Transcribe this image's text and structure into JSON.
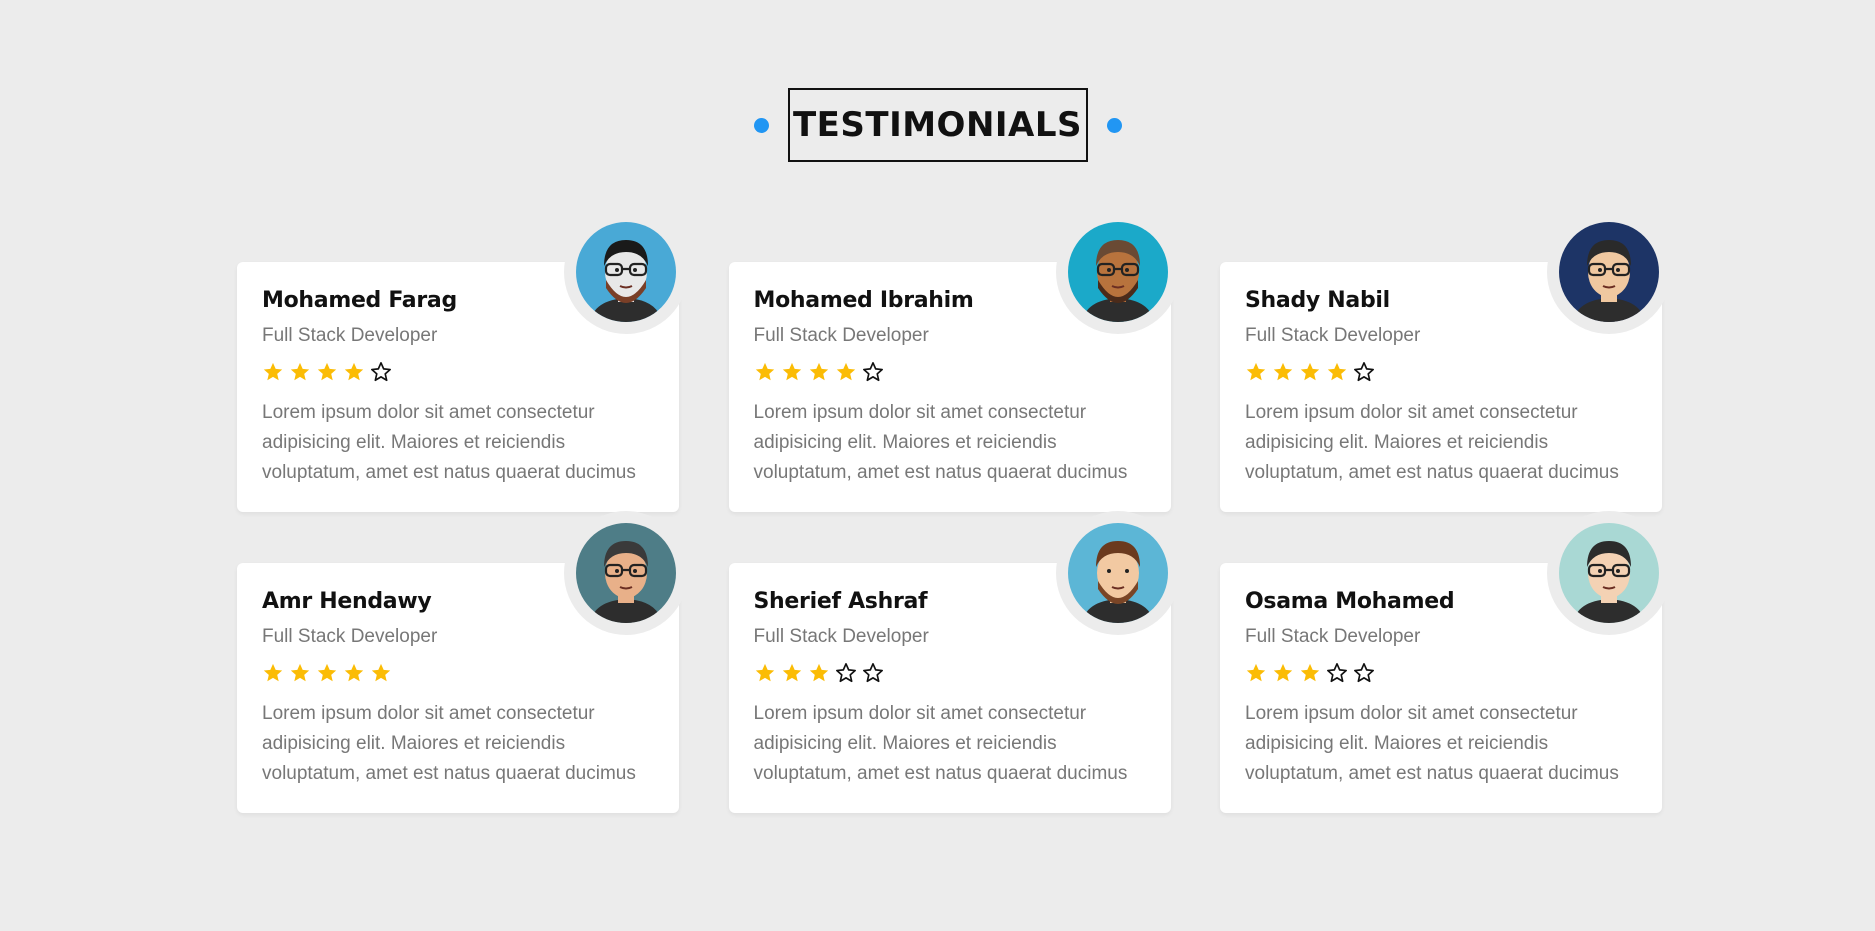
{
  "heading": {
    "title": "TESTIMONIALS",
    "accent_color": "#2196f3"
  },
  "colors": {
    "star_filled": "#fbbc05",
    "star_empty_outline": "#111111"
  },
  "testimonials": [
    {
      "name": "Mohamed Farag",
      "role": "Full Stack Developer",
      "rating": 4,
      "max_rating": 5,
      "text": "Lorem ipsum dolor sit amet consectetur adipisicing elit. Maiores et reiciendis voluptatum, amet est natus quaerat ducimus",
      "avatar": {
        "icon": "avatar-bearded-beanie-icon",
        "bg": "#49a9d6",
        "skin": "#e8e8e8",
        "hair": "#1a1a1a",
        "beard": "#7a3f27",
        "glasses": true
      }
    },
    {
      "name": "Mohamed Ibrahim",
      "role": "Full Stack Developer",
      "rating": 4,
      "max_rating": 5,
      "text": "Lorem ipsum dolor sit amet consectetur adipisicing elit. Maiores et reiciendis voluptatum, amet est natus quaerat ducimus",
      "avatar": {
        "icon": "avatar-sunglasses-man-icon",
        "bg": "#1ba9c9",
        "skin": "#b8733d",
        "hair": "#6a4a34",
        "beard": "#4b2b1a",
        "glasses": true
      }
    },
    {
      "name": "Shady Nabil",
      "role": "Full Stack Developer",
      "rating": 4,
      "max_rating": 5,
      "text": "Lorem ipsum dolor sit amet consectetur adipisicing elit. Maiores et reiciendis voluptatum, amet est natus quaerat ducimus",
      "avatar": {
        "icon": "avatar-glasses-man-icon",
        "bg": "#1d3466",
        "skin": "#f0c8a0",
        "hair": "#2a2a2a",
        "beard": "",
        "glasses": true
      }
    },
    {
      "name": "Amr Hendawy",
      "role": "Full Stack Developer",
      "rating": 5,
      "max_rating": 5,
      "text": "Lorem ipsum dolor sit amet consectetur adipisicing elit. Maiores et reiciendis voluptatum, amet est natus quaerat ducimus",
      "avatar": {
        "icon": "avatar-pink-glasses-man-icon",
        "bg": "#4e7d87",
        "skin": "#e8b089",
        "hair": "#3a3a3a",
        "beard": "",
        "glasses": true
      }
    },
    {
      "name": "Sherief Ashraf",
      "role": "Full Stack Developer",
      "rating": 3,
      "max_rating": 5,
      "text": "Lorem ipsum dolor sit amet consectetur adipisicing elit. Maiores et reiciendis voluptatum, amet est natus quaerat ducimus",
      "avatar": {
        "icon": "avatar-bearded-man-icon",
        "bg": "#5cb6d6",
        "skin": "#f2c9a2",
        "hair": "#6b3a1e",
        "beard": "#7a4526",
        "glasses": false
      }
    },
    {
      "name": "Osama Mohamed",
      "role": "Full Stack Developer",
      "rating": 3,
      "max_rating": 5,
      "text": "Lorem ipsum dolor sit amet consectetur adipisicing elit. Maiores et reiciendis voluptatum, amet est natus quaerat ducimus",
      "avatar": {
        "icon": "avatar-sunglasses-man-icon",
        "bg": "#a9d8d4",
        "skin": "#f4d2b4",
        "hair": "#2b2b2b",
        "beard": "",
        "glasses": true
      }
    }
  ]
}
